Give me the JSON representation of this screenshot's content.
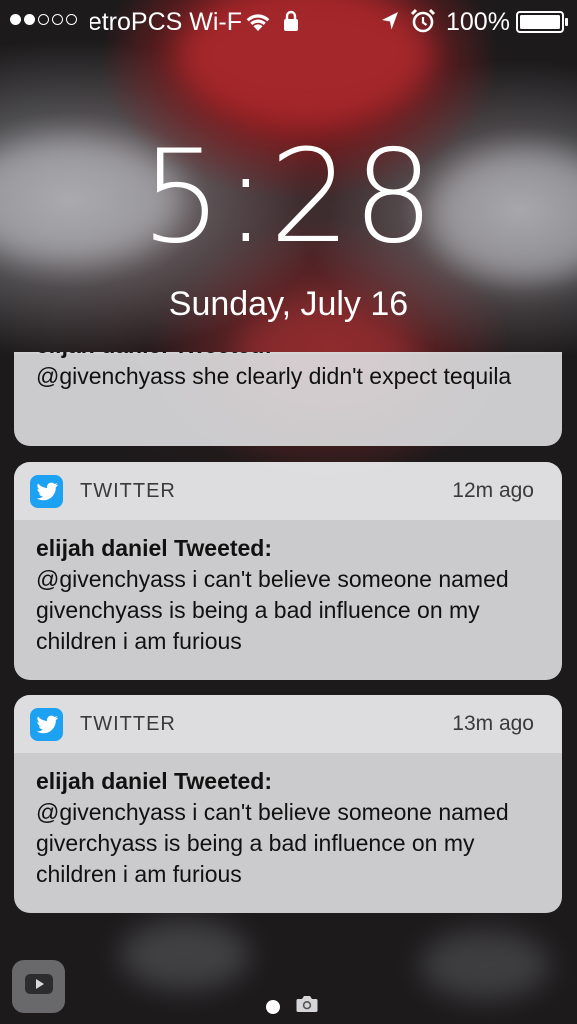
{
  "status_bar": {
    "signal_full": 2,
    "signal_total": 5,
    "carrier_wifi": "etroPCS Wi-F",
    "battery_percent": "100%",
    "icons": [
      "wifi-icon",
      "lock-icon",
      "location-arrow-icon",
      "alarm-clock-icon",
      "battery-icon"
    ]
  },
  "lock_screen": {
    "time": "5:28",
    "date": "Sunday, July 16"
  },
  "notifications": {
    "partial": {
      "title": "elijah daniel Tweeted:",
      "message": "@givenchyass she clearly didn't expect tequila"
    },
    "items": [
      {
        "app": "TWITTER",
        "time_ago": "12m ago",
        "title": "elijah daniel Tweeted:",
        "message": "@givenchyass i can't believe someone named givenchyass is being a bad influence on my children i am furious"
      },
      {
        "app": "TWITTER",
        "time_ago": "13m ago",
        "title": "elijah daniel Tweeted:",
        "message": "@givenchyass i can't believe someone named giverchyass is being a bad influence on my children i am furious"
      }
    ]
  },
  "bottom": {
    "media_icon": "youtube-play-icon",
    "page_indicator": [
      "dot",
      "camera"
    ]
  },
  "colors": {
    "twitter_blue": "#1da1f2",
    "card_background": "#dadadc",
    "text_dark": "#111111",
    "status_text": "#ffffff"
  }
}
